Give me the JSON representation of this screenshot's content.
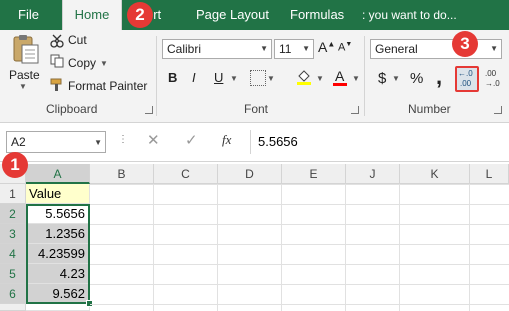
{
  "tabs": [
    {
      "label": "File"
    },
    {
      "label": "Home"
    },
    {
      "label": "ert"
    },
    {
      "label": "Page Layout"
    },
    {
      "label": "Formulas"
    },
    {
      "label": "you want to do..."
    }
  ],
  "clipboard": {
    "paste_label": "Paste",
    "cut_label": "Cut",
    "copy_label": "Copy",
    "format_painter_label": "Format Painter",
    "group_label": "Clipboard"
  },
  "font": {
    "name": "Calibri",
    "size": "11",
    "bold": "B",
    "italic": "I",
    "underline": "U",
    "color_glyph": "A",
    "grow_glyph": "A",
    "shrink_glyph": "A",
    "group_label": "Font",
    "accent_fill": "#ffff00",
    "accent_font": "#ff0000"
  },
  "number": {
    "format": "General",
    "currency": "$",
    "percent": "%",
    "comma": ",",
    "inc_decimal_top": "←.0",
    "inc_decimal_bottom": ".00",
    "dec_decimal_top": ".00",
    "dec_decimal_bottom": "→.0",
    "group_label": "Number"
  },
  "formula_bar": {
    "name_box": "A2",
    "fx": "fx",
    "value": "5.5656"
  },
  "grid": {
    "columns": [
      "A",
      "B",
      "C",
      "D",
      "E",
      "J",
      "K",
      "L"
    ],
    "rows": [
      "1",
      "2",
      "3",
      "4",
      "5",
      "6"
    ],
    "a_values": [
      "Value",
      "5.5656",
      "1.2356",
      "4.23599",
      "4.23",
      "9.562"
    ]
  },
  "badges": [
    "1",
    "2",
    "3"
  ],
  "colors": {
    "brand_green": "#217346",
    "badge_red": "#e53935",
    "selection_gray": "#d2d2d2"
  }
}
